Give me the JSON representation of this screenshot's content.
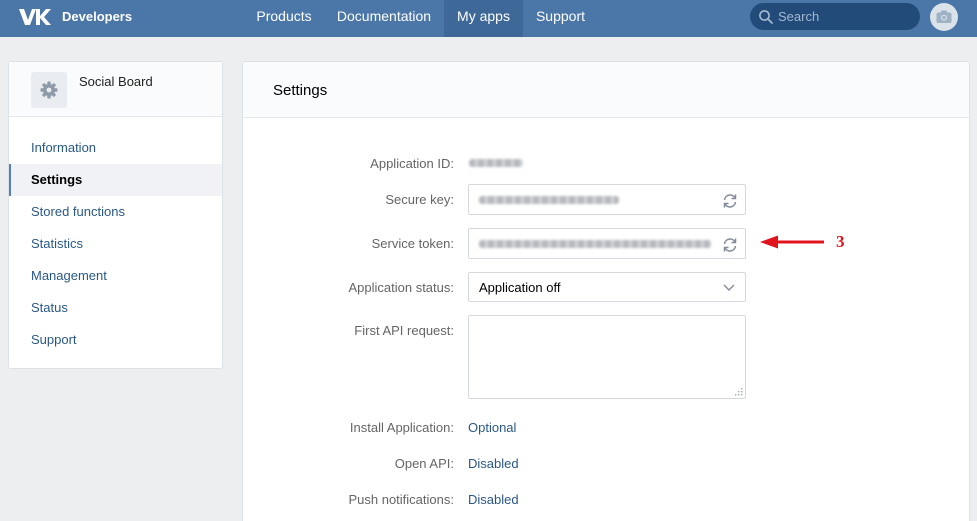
{
  "header": {
    "brand": "Developers",
    "nav": [
      "Products",
      "Documentation",
      "My apps",
      "Support"
    ],
    "search_placeholder": "Search"
  },
  "sidebar": {
    "app_name": "Social Board",
    "items": [
      "Information",
      "Settings",
      "Stored functions",
      "Statistics",
      "Management",
      "Status",
      "Support"
    ]
  },
  "main": {
    "title": "Settings",
    "application_id_label": "Application ID:",
    "secure_key_label": "Secure key:",
    "service_token_label": "Service token:",
    "application_status_label": "Application status:",
    "application_status_value": "Application off",
    "first_api_request_label": "First API request:",
    "install_application_label": "Install Application:",
    "install_application_value": "Optional",
    "open_api_label": "Open API:",
    "open_api_value": "Disabled",
    "push_notifications_label": "Push notifications:",
    "push_notifications_value": "Disabled"
  },
  "annotation": {
    "number": "3"
  },
  "icons": [
    "vk-logo-icon",
    "search-icon",
    "camera-icon",
    "gear-icon",
    "refresh-icon",
    "chevron-down-icon",
    "resize-handle-icon",
    "red-arrow-icon"
  ],
  "colors": {
    "header": "#4a76a8",
    "link": "#2a5885",
    "annotation": "#e0141c"
  }
}
